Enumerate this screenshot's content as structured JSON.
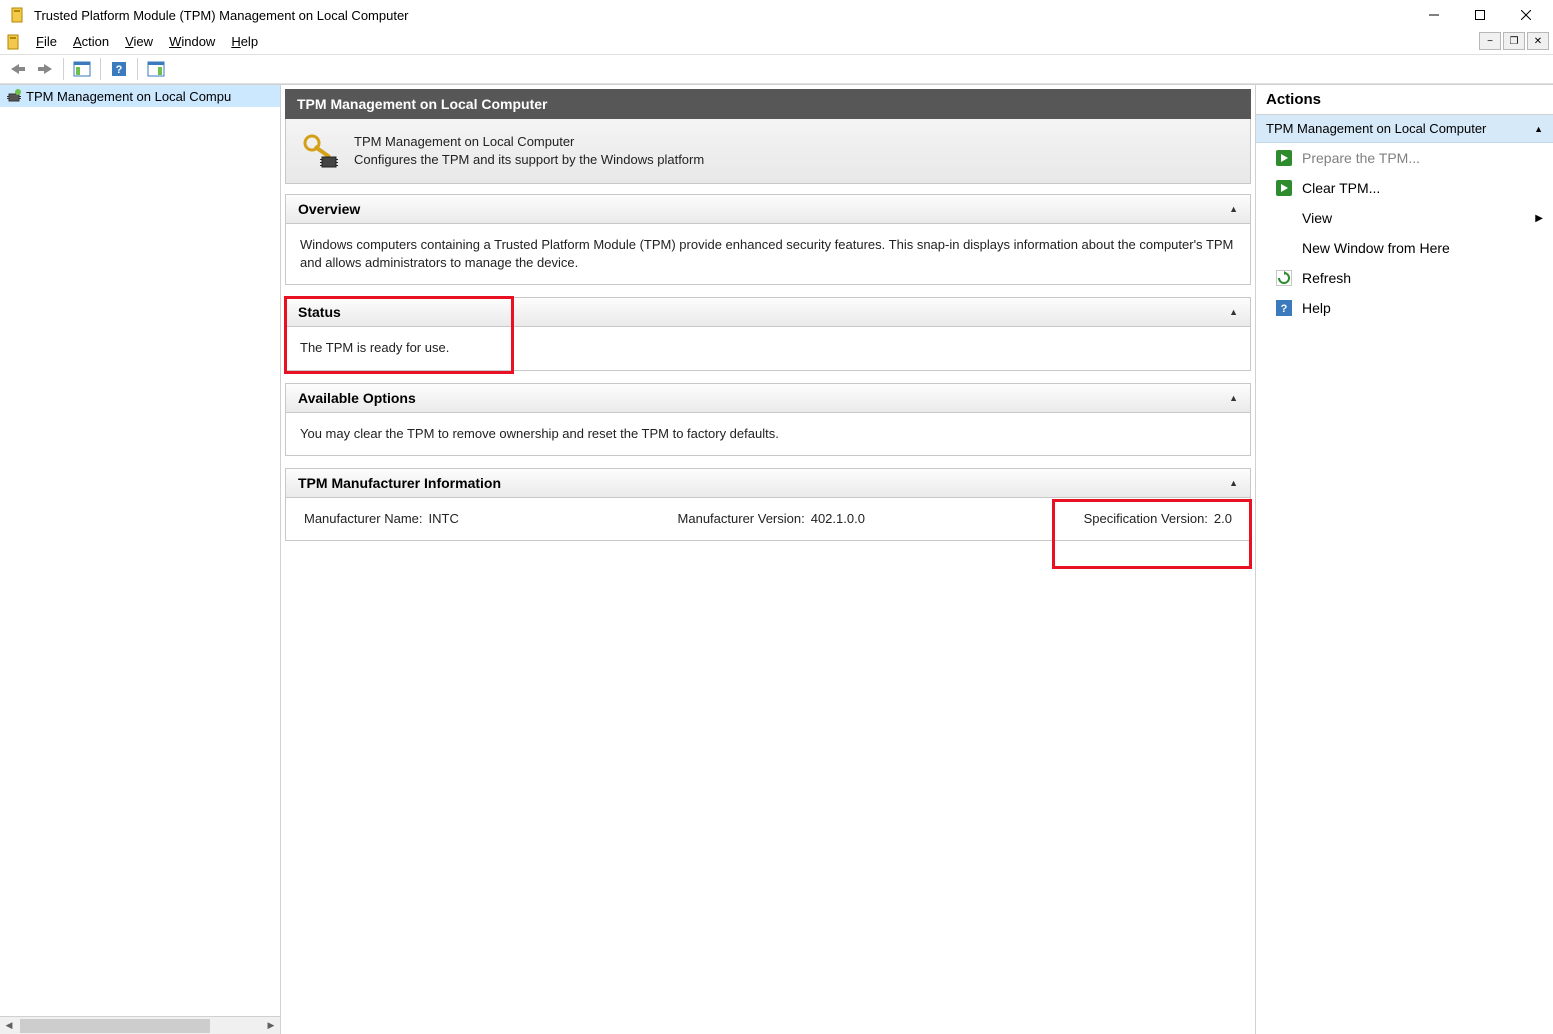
{
  "window": {
    "title": "Trusted Platform Module (TPM) Management on Local Computer"
  },
  "menubar": {
    "file": "File",
    "action": "Action",
    "view": "View",
    "window": "Window",
    "help": "Help"
  },
  "tree": {
    "root_label": "TPM Management on Local Compu"
  },
  "content": {
    "header": "TPM Management on Local Computer",
    "top_title": "TPM Management on Local Computer",
    "top_desc": "Configures the TPM and its support by the Windows platform",
    "overview": {
      "title": "Overview",
      "body": "Windows computers containing a Trusted Platform Module (TPM) provide enhanced security features. This snap-in displays information about the computer's TPM and allows administrators to manage the device."
    },
    "status": {
      "title": "Status",
      "body": "The TPM is ready for use."
    },
    "options": {
      "title": "Available Options",
      "body": "You may clear the TPM to remove ownership and reset the TPM to factory defaults."
    },
    "mfr": {
      "title": "TPM Manufacturer Information",
      "name_label": "Manufacturer Name:",
      "name_value": "INTC",
      "version_label": "Manufacturer Version:",
      "version_value": "402.1.0.0",
      "spec_label": "Specification Version:",
      "spec_value": "2.0"
    }
  },
  "actions": {
    "title": "Actions",
    "subheader": "TPM Management on Local Computer",
    "prepare": "Prepare the TPM...",
    "clear": "Clear TPM...",
    "view": "View",
    "new_window": "New Window from Here",
    "refresh": "Refresh",
    "help": "Help"
  }
}
